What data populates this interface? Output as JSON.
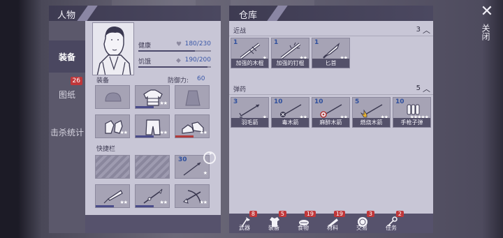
{
  "character": {
    "title": "人物",
    "tabs": [
      {
        "label": "装备",
        "badge": ""
      },
      {
        "label": "图纸",
        "badge": "26"
      },
      {
        "label": "击杀统计",
        "badge": ""
      }
    ],
    "stats": {
      "health_label": "健康",
      "health_value": "180/230",
      "health_fraction": 0.78,
      "hunger_label": "饥饿",
      "hunger_value": "190/200",
      "hunger_fraction": 0.95
    },
    "equipment_label": "装备",
    "defense_label": "防御力:",
    "defense_value": "60",
    "quickbar_label": "快捷栏",
    "quickbar_slot_count": "30"
  },
  "warehouse": {
    "title": "仓库",
    "categories": [
      {
        "label": "近战",
        "count": "3",
        "items": [
          {
            "count": "1",
            "name": "加强的木棍",
            "stars": "★",
            "gold": true,
            "bar": "red"
          },
          {
            "count": "1",
            "name": "加强的钉棍",
            "stars": "★★",
            "gold": true,
            "bar": "blue"
          },
          {
            "count": "1",
            "name": "匕首",
            "stars": "★★",
            "gold": false,
            "bar": "red"
          }
        ]
      },
      {
        "label": "弹药",
        "count": "5",
        "items": [
          {
            "count": "3",
            "name": "羽毛箭",
            "stars": "★",
            "gold": false,
            "bar": ""
          },
          {
            "count": "10",
            "name": "毒木箭",
            "stars": "★★",
            "gold": false,
            "bar": ""
          },
          {
            "count": "10",
            "name": "麻醉木箭",
            "stars": "★★",
            "gold": false,
            "bar": ""
          },
          {
            "count": "5",
            "name": "燃烧木箭",
            "stars": "★★",
            "gold": true,
            "bar": ""
          },
          {
            "count": "10",
            "name": "手枪子弹",
            "stars": "★★★★★",
            "gold": true,
            "bar": ""
          }
        ]
      }
    ],
    "bottom_tabs": [
      {
        "label": "武器",
        "badge": "8",
        "icon": "axe-icon"
      },
      {
        "label": "装备",
        "badge": "5",
        "icon": "shirt-icon"
      },
      {
        "label": "食物",
        "badge": "19",
        "icon": "food-icon"
      },
      {
        "label": "材料",
        "badge": "19",
        "icon": "wood-icon"
      },
      {
        "label": "交易",
        "badge": "3",
        "icon": "coin-icon"
      },
      {
        "label": "任务",
        "badge": "2",
        "icon": "key-icon"
      }
    ]
  },
  "close": {
    "label": "关闭"
  }
}
